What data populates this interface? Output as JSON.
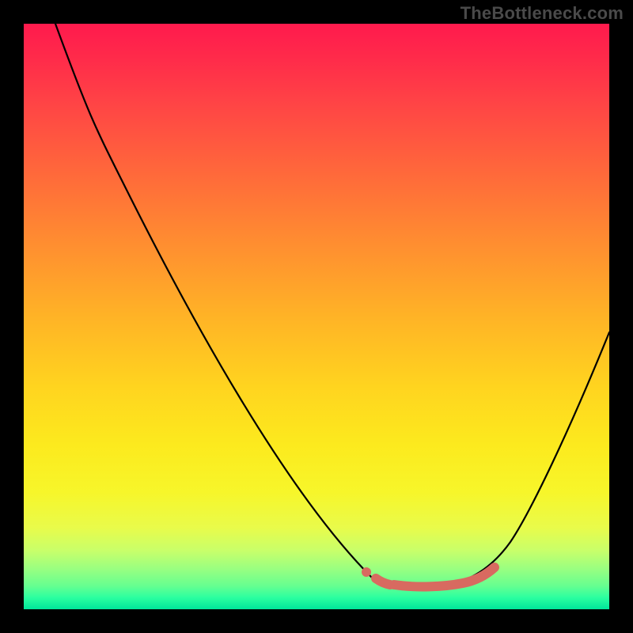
{
  "watermark": "TheBottleneck.com",
  "colors": {
    "gradient_top": "#ff1a4d",
    "gradient_mid": "#ffd41f",
    "gradient_bottom": "#00e59a",
    "curve": "#000000",
    "marker": "#d86a60",
    "frame": "#000000"
  },
  "chart_data": {
    "type": "line",
    "title": "",
    "xlabel": "",
    "ylabel": "",
    "xlim": [
      0,
      100
    ],
    "ylim": [
      0,
      100
    ],
    "grid": false,
    "legend": false,
    "description": "Bottleneck curve: V-shaped black line over a vertical red→yellow→green gradient. Minimum lies in the green band (~x 66–78). Salmon markers highlight the flat optimum span around the trough.",
    "series": [
      {
        "name": "bottleneck_percentage",
        "x": [
          5,
          12,
          18,
          28,
          40,
          52,
          60,
          66,
          70,
          74,
          78,
          82,
          88,
          94,
          100
        ],
        "values": [
          100,
          85,
          72,
          52,
          32,
          18,
          10,
          5,
          4,
          4,
          5,
          9,
          20,
          34,
          48
        ]
      }
    ],
    "annotations": [
      {
        "name": "optimal_range",
        "x_start": 60,
        "x_end": 80,
        "style": "salmon-rounded-stroke"
      }
    ]
  }
}
